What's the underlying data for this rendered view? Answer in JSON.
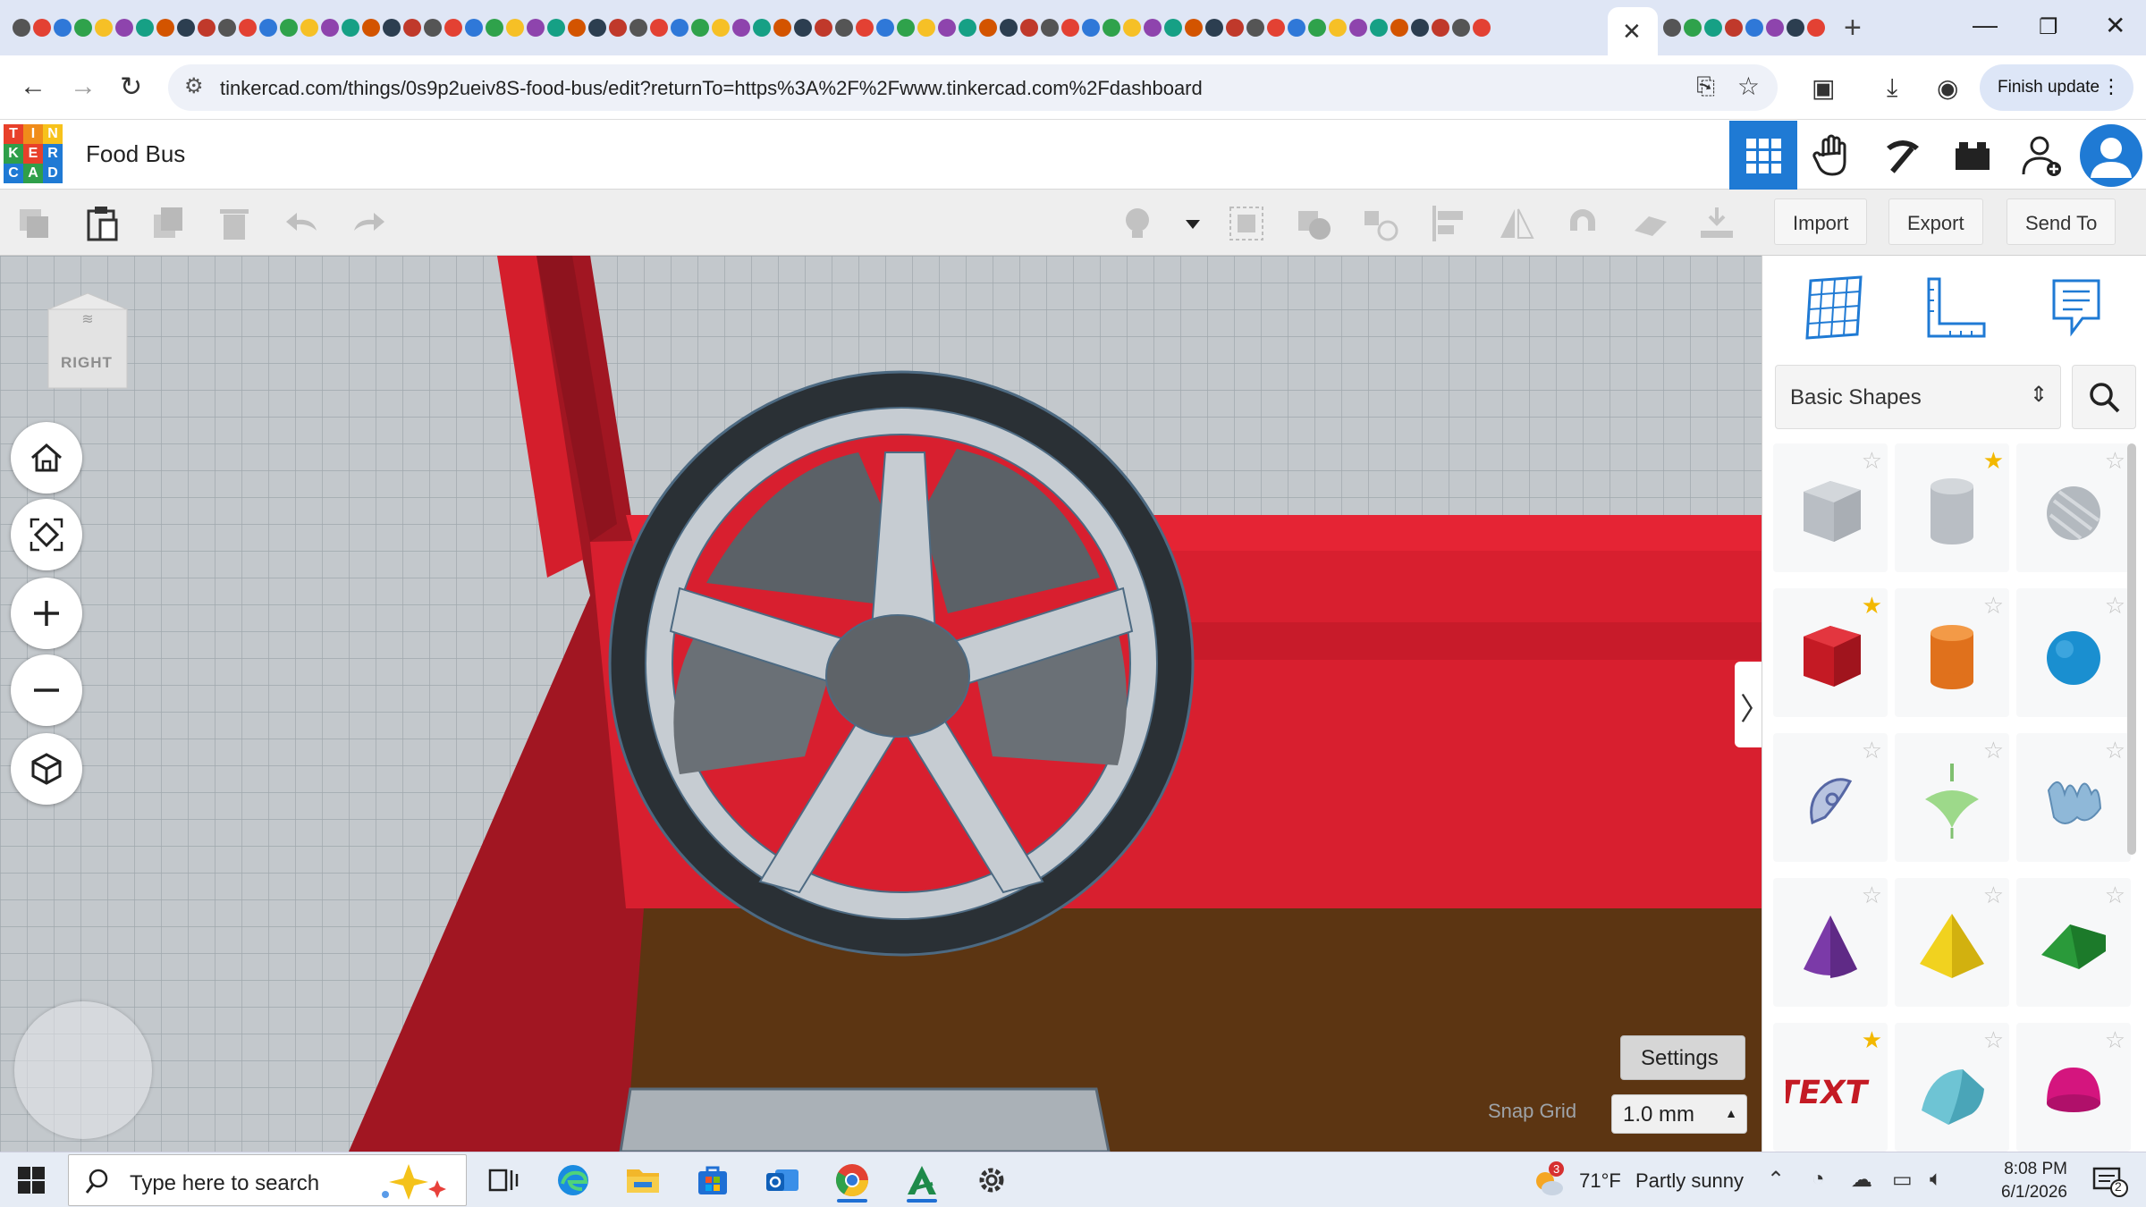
{
  "browser": {
    "url": "tinkercad.com/things/0s9p2ueiv8S-food-bus/edit?returnTo=https%3A%2F%2Fwww.tinkercad.com%2Fdashboard",
    "finish_update_label": "Finish update",
    "new_tab_label": "+"
  },
  "app": {
    "logo_letters": [
      "T",
      "I",
      "N",
      "K",
      "E",
      "R",
      "C",
      "A",
      "D"
    ],
    "logo_colors": [
      "#e8402a",
      "#f08c1a",
      "#f7c21b",
      "#2f9f4a",
      "#e8402a",
      "#1f7ad4",
      "#1f7ad4",
      "#2f9f4a",
      "#1f7ad4"
    ],
    "design_title": "Food Bus",
    "accent_color": "#1f7ad4"
  },
  "toolbar": {
    "import_label": "Import",
    "export_label": "Export",
    "send_to_label": "Send To"
  },
  "viewport": {
    "viewcube_face": "RIGHT",
    "settings_label": "Settings",
    "snap_grid_label": "Snap Grid",
    "snap_grid_value": "1.0 mm"
  },
  "panel": {
    "shape_category": "Basic Shapes",
    "shapes": [
      {
        "name": "box-hole",
        "starred": false
      },
      {
        "name": "cylinder-hole",
        "starred": true
      },
      {
        "name": "sphere-hole",
        "starred": false
      },
      {
        "name": "box",
        "starred": true
      },
      {
        "name": "cylinder",
        "starred": false
      },
      {
        "name": "sphere",
        "starred": false
      },
      {
        "name": "scribble",
        "starred": false
      },
      {
        "name": "spinning-top",
        "starred": false
      },
      {
        "name": "shape-generator",
        "starred": false
      },
      {
        "name": "cone",
        "starred": false
      },
      {
        "name": "pyramid",
        "starred": false
      },
      {
        "name": "roof",
        "starred": false
      },
      {
        "name": "text",
        "starred": true
      },
      {
        "name": "half-cylinder",
        "starred": false
      },
      {
        "name": "paraboloid",
        "starred": false
      }
    ]
  },
  "taskbar": {
    "search_placeholder": "Type here to search",
    "weather_temp": "71°F",
    "weather_text": "Partly sunny",
    "weather_badge": "3",
    "time": "8:08 PM",
    "date": "6/1/2026",
    "notification_count": "2"
  }
}
